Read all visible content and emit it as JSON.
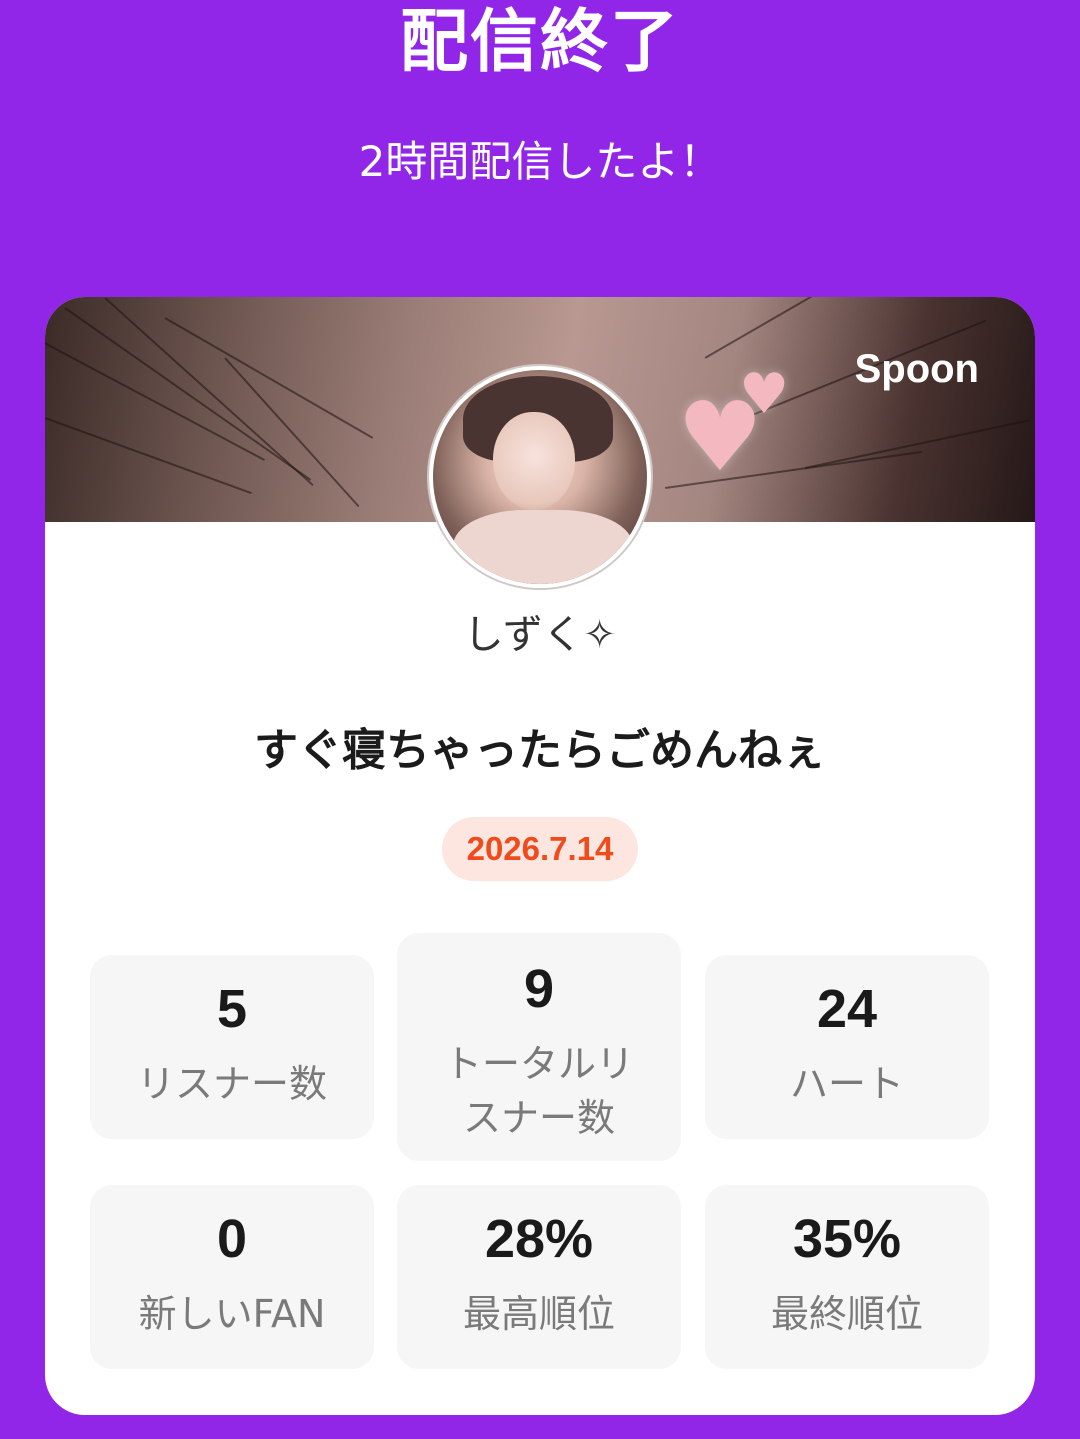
{
  "header": {
    "title": "配信終了",
    "subtitle": "2時間配信したよ！"
  },
  "card": {
    "brand": "Spoon",
    "username": "しずく✧",
    "stream_title": "すぐ寝ちゃったらごめんねぇ",
    "date": "2026.7.14",
    "stats": [
      {
        "value": "5",
        "label": "リスナー数"
      },
      {
        "value": "9",
        "label": "トータルリスナー数"
      },
      {
        "value": "24",
        "label": "ハート"
      },
      {
        "value": "0",
        "label": "新しいFAN"
      },
      {
        "value": "28%",
        "label": "最高順位"
      },
      {
        "value": "35%",
        "label": "最終順位"
      }
    ]
  },
  "colors": {
    "background": "#9226e8",
    "card": "#ffffff",
    "date_text": "#f04b1c",
    "date_bg": "#fde6df",
    "stat_bg": "#f6f6f6"
  },
  "icons": [
    "spoon-logo",
    "avatar-image",
    "banner-image"
  ]
}
